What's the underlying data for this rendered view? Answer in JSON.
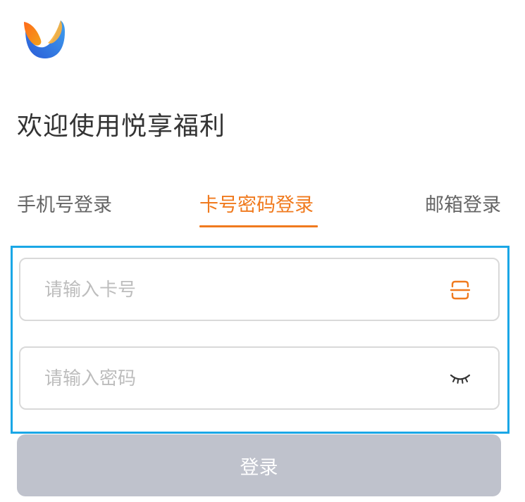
{
  "header": {
    "logo_icon": "app-logo-icon",
    "welcome_title": "欢迎使用悦享福利"
  },
  "tabs": [
    {
      "label": "手机号登录",
      "active": false
    },
    {
      "label": "卡号密码登录",
      "active": true
    },
    {
      "label": "邮箱登录",
      "active": false
    }
  ],
  "form": {
    "card_field": {
      "value": "",
      "placeholder": "请输入卡号",
      "icon": "scan-icon"
    },
    "password_field": {
      "value": "",
      "placeholder": "请输入密码",
      "icon": "eye-closed-icon"
    },
    "login_label": "登录"
  },
  "colors": {
    "accent": "#f07a1e",
    "focus_border": "#1aa7e6",
    "disabled_button": "#bfc2cc",
    "text_primary": "#333333",
    "text_secondary": "#666666",
    "placeholder": "#bdbdbd"
  }
}
